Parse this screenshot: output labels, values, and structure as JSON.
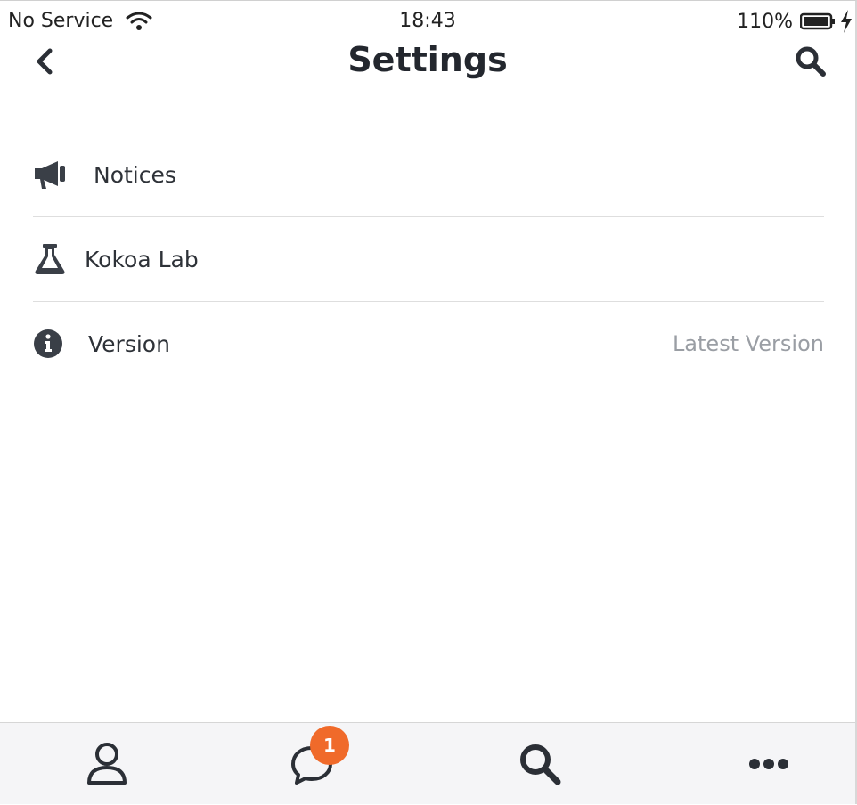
{
  "status_bar": {
    "carrier": "No Service",
    "time": "18:43",
    "battery": "110%"
  },
  "nav": {
    "title": "Settings",
    "back_icon": "chevron-left-icon",
    "search_icon": "search-icon"
  },
  "settings_items": [
    {
      "label": "Notices",
      "icon": "megaphone-icon",
      "value": ""
    },
    {
      "label": "Kokoa Lab",
      "icon": "flask-icon",
      "value": ""
    },
    {
      "label": "Version",
      "icon": "info-circle-icon",
      "value": "Latest Version"
    }
  ],
  "tab_bar": {
    "tabs": [
      {
        "icon": "person-icon"
      },
      {
        "icon": "chat-bubble-icon",
        "badge": "1"
      },
      {
        "icon": "search-icon"
      },
      {
        "icon": "more-dots-icon"
      }
    ]
  },
  "colors": {
    "icon": "#2b2f36",
    "badge": "#f06a2a",
    "secondary_text": "#9a9ea4",
    "tab_bar_bg": "#f5f5f7"
  }
}
